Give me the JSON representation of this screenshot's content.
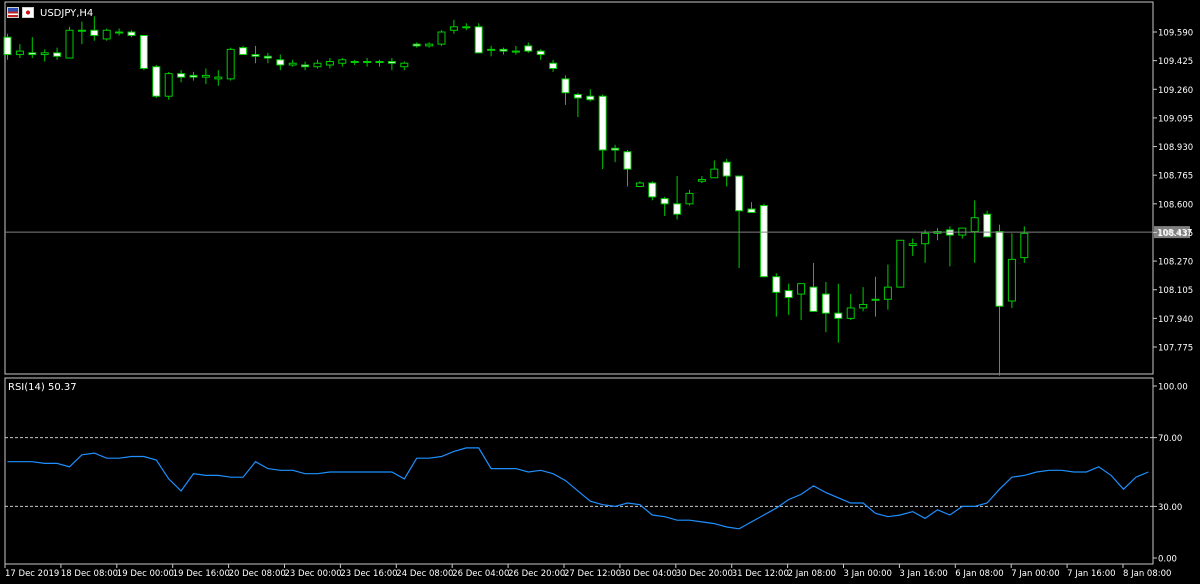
{
  "window": {
    "title": "USDJPY,H4"
  },
  "colors": {
    "background": "#000000",
    "frame": "#c8c8c8",
    "text": "#ffffff",
    "up_candle_body": "#000000",
    "down_candle_body": "#ffffff",
    "wick": "#00cc00",
    "bid_line": "#808080",
    "price_tag_bg": "#808080",
    "rsi_line": "#1e90ff",
    "rsi_levels": "#c8c8c8"
  },
  "chart_data": [
    {
      "type": "candlestick",
      "title": "USDJPY,H4",
      "symbol": "USDJPY",
      "timeframe": "H4",
      "y_ticks": [
        "109.590",
        "109.425",
        "109.260",
        "109.095",
        "108.930",
        "108.765",
        "108.600",
        "108.435",
        "108.270",
        "108.105",
        "107.940",
        "107.775"
      ],
      "ylim": [
        107.68,
        109.69
      ],
      "current_price_label": "108.437",
      "current_price": 108.437,
      "x_tick_labels": [
        "17 Dec 2019",
        "18 Dec 08:00",
        "19 Dec 00:00",
        "19 Dec 16:00",
        "20 Dec 08:00",
        "23 Dec 00:00",
        "23 Dec 16:00",
        "24 Dec 08:00",
        "26 Dec 04:00",
        "26 Dec 20:00",
        "27 Dec 12:00",
        "30 Dec 04:00",
        "30 Dec 20:00",
        "31 Dec 12:00",
        "2 Jan 08:00",
        "3 Jan 00:00",
        "3 Jan 16:00",
        "6 Jan 08:00",
        "7 Jan 00:00",
        "7 Jan 16:00",
        "8 Jan 08:00"
      ],
      "candles": [
        {
          "o": 109.56,
          "h": 109.58,
          "l": 109.43,
          "c": 109.46
        },
        {
          "o": 109.46,
          "h": 109.52,
          "l": 109.44,
          "c": 109.48
        },
        {
          "o": 109.47,
          "h": 109.56,
          "l": 109.44,
          "c": 109.46
        },
        {
          "o": 109.46,
          "h": 109.49,
          "l": 109.42,
          "c": 109.47
        },
        {
          "o": 109.47,
          "h": 109.5,
          "l": 109.43,
          "c": 109.45
        },
        {
          "o": 109.44,
          "h": 109.62,
          "l": 109.44,
          "c": 109.6
        },
        {
          "o": 109.6,
          "h": 109.65,
          "l": 109.52,
          "c": 109.6
        },
        {
          "o": 109.6,
          "h": 109.68,
          "l": 109.54,
          "c": 109.57
        },
        {
          "o": 109.55,
          "h": 109.61,
          "l": 109.54,
          "c": 109.6
        },
        {
          "o": 109.59,
          "h": 109.61,
          "l": 109.57,
          "c": 109.59
        },
        {
          "o": 109.59,
          "h": 109.6,
          "l": 109.56,
          "c": 109.57
        },
        {
          "o": 109.57,
          "h": 109.57,
          "l": 109.37,
          "c": 109.38
        },
        {
          "o": 109.39,
          "h": 109.4,
          "l": 109.21,
          "c": 109.22
        },
        {
          "o": 109.22,
          "h": 109.36,
          "l": 109.2,
          "c": 109.35
        },
        {
          "o": 109.35,
          "h": 109.37,
          "l": 109.3,
          "c": 109.33
        },
        {
          "o": 109.34,
          "h": 109.36,
          "l": 109.31,
          "c": 109.33
        },
        {
          "o": 109.33,
          "h": 109.38,
          "l": 109.29,
          "c": 109.34
        },
        {
          "o": 109.32,
          "h": 109.37,
          "l": 109.28,
          "c": 109.33
        },
        {
          "o": 109.32,
          "h": 109.5,
          "l": 109.31,
          "c": 109.49
        },
        {
          "o": 109.5,
          "h": 109.51,
          "l": 109.46,
          "c": 109.46
        },
        {
          "o": 109.46,
          "h": 109.51,
          "l": 109.41,
          "c": 109.45
        },
        {
          "o": 109.45,
          "h": 109.47,
          "l": 109.41,
          "c": 109.44
        },
        {
          "o": 109.43,
          "h": 109.46,
          "l": 109.37,
          "c": 109.4
        },
        {
          "o": 109.4,
          "h": 109.43,
          "l": 109.39,
          "c": 109.41
        },
        {
          "o": 109.4,
          "h": 109.42,
          "l": 109.37,
          "c": 109.39
        },
        {
          "o": 109.39,
          "h": 109.43,
          "l": 109.38,
          "c": 109.41
        },
        {
          "o": 109.4,
          "h": 109.44,
          "l": 109.38,
          "c": 109.42
        },
        {
          "o": 109.41,
          "h": 109.44,
          "l": 109.39,
          "c": 109.43
        },
        {
          "o": 109.42,
          "h": 109.43,
          "l": 109.4,
          "c": 109.42
        },
        {
          "o": 109.42,
          "h": 109.44,
          "l": 109.39,
          "c": 109.42
        },
        {
          "o": 109.42,
          "h": 109.43,
          "l": 109.39,
          "c": 109.42
        },
        {
          "o": 109.42,
          "h": 109.44,
          "l": 109.37,
          "c": 109.41
        },
        {
          "o": 109.39,
          "h": 109.42,
          "l": 109.37,
          "c": 109.41
        },
        {
          "o": 109.52,
          "h": 109.53,
          "l": 109.5,
          "c": 109.51
        },
        {
          "o": 109.51,
          "h": 109.53,
          "l": 109.5,
          "c": 109.52
        },
        {
          "o": 109.52,
          "h": 109.6,
          "l": 109.51,
          "c": 109.59
        },
        {
          "o": 109.6,
          "h": 109.66,
          "l": 109.58,
          "c": 109.62
        },
        {
          "o": 109.62,
          "h": 109.64,
          "l": 109.6,
          "c": 109.62
        },
        {
          "o": 109.62,
          "h": 109.64,
          "l": 109.47,
          "c": 109.47
        },
        {
          "o": 109.49,
          "h": 109.51,
          "l": 109.45,
          "c": 109.49
        },
        {
          "o": 109.49,
          "h": 109.5,
          "l": 109.46,
          "c": 109.48
        },
        {
          "o": 109.48,
          "h": 109.51,
          "l": 109.46,
          "c": 109.48
        },
        {
          "o": 109.51,
          "h": 109.53,
          "l": 109.47,
          "c": 109.48
        },
        {
          "o": 109.48,
          "h": 109.49,
          "l": 109.43,
          "c": 109.46
        },
        {
          "o": 109.41,
          "h": 109.43,
          "l": 109.36,
          "c": 109.38
        },
        {
          "o": 109.32,
          "h": 109.34,
          "l": 109.17,
          "c": 109.24
        },
        {
          "o": 109.23,
          "h": 109.24,
          "l": 109.1,
          "c": 109.21
        },
        {
          "o": 109.22,
          "h": 109.26,
          "l": 109.19,
          "c": 109.2
        },
        {
          "o": 109.22,
          "h": 109.23,
          "l": 108.8,
          "c": 108.91
        },
        {
          "o": 108.92,
          "h": 108.94,
          "l": 108.84,
          "c": 108.91
        },
        {
          "o": 108.9,
          "h": 108.91,
          "l": 108.7,
          "c": 108.8
        },
        {
          "o": 108.7,
          "h": 108.73,
          "l": 108.71,
          "c": 108.72
        },
        {
          "o": 108.72,
          "h": 108.73,
          "l": 108.62,
          "c": 108.64
        },
        {
          "o": 108.63,
          "h": 108.64,
          "l": 108.53,
          "c": 108.6
        },
        {
          "o": 108.6,
          "h": 108.76,
          "l": 108.51,
          "c": 108.54
        },
        {
          "o": 108.6,
          "h": 108.68,
          "l": 108.59,
          "c": 108.66
        },
        {
          "o": 108.73,
          "h": 108.76,
          "l": 108.72,
          "c": 108.74
        },
        {
          "o": 108.75,
          "h": 108.85,
          "l": 108.75,
          "c": 108.8
        },
        {
          "o": 108.84,
          "h": 108.86,
          "l": 108.7,
          "c": 108.76
        },
        {
          "o": 108.76,
          "h": 108.73,
          "l": 108.23,
          "c": 108.56
        },
        {
          "o": 108.57,
          "h": 108.61,
          "l": 108.56,
          "c": 108.55
        },
        {
          "o": 108.59,
          "h": 108.6,
          "l": 108.19,
          "c": 108.18
        },
        {
          "o": 108.18,
          "h": 108.2,
          "l": 107.95,
          "c": 108.09
        },
        {
          "o": 108.1,
          "h": 108.14,
          "l": 107.96,
          "c": 108.06
        },
        {
          "o": 108.08,
          "h": 108.13,
          "l": 107.93,
          "c": 108.14
        },
        {
          "o": 108.12,
          "h": 108.26,
          "l": 107.98,
          "c": 107.98
        },
        {
          "o": 108.08,
          "h": 108.15,
          "l": 107.86,
          "c": 107.97
        },
        {
          "o": 107.97,
          "h": 108.14,
          "l": 107.8,
          "c": 107.94
        },
        {
          "o": 107.94,
          "h": 108.08,
          "l": 107.93,
          "c": 108.0
        },
        {
          "o": 108.0,
          "h": 108.12,
          "l": 107.98,
          "c": 108.02
        },
        {
          "o": 108.05,
          "h": 108.18,
          "l": 107.95,
          "c": 108.05
        },
        {
          "o": 108.05,
          "h": 108.25,
          "l": 107.99,
          "c": 108.12
        },
        {
          "o": 108.12,
          "h": 108.36,
          "l": 108.14,
          "c": 108.39
        },
        {
          "o": 108.36,
          "h": 108.4,
          "l": 108.3,
          "c": 108.37
        },
        {
          "o": 108.37,
          "h": 108.45,
          "l": 108.26,
          "c": 108.43
        },
        {
          "o": 108.43,
          "h": 108.46,
          "l": 108.39,
          "c": 108.44
        },
        {
          "o": 108.45,
          "h": 108.47,
          "l": 108.24,
          "c": 108.42
        },
        {
          "o": 108.42,
          "h": 108.44,
          "l": 108.4,
          "c": 108.46
        },
        {
          "o": 108.44,
          "h": 108.62,
          "l": 108.26,
          "c": 108.52
        },
        {
          "o": 108.54,
          "h": 108.56,
          "l": 108.41,
          "c": 108.41
        },
        {
          "o": 108.44,
          "h": 108.48,
          "l": 107.61,
          "c": 108.01
        },
        {
          "o": 108.04,
          "h": 108.43,
          "l": 108.0,
          "c": 108.28
        },
        {
          "o": 108.29,
          "h": 108.47,
          "l": 108.26,
          "c": 108.43
        }
      ]
    },
    {
      "type": "line",
      "title": "RSI(14) 50.37",
      "indicator": "RSI(14)",
      "current_value": 50.37,
      "ylim": [
        0,
        100
      ],
      "y_ticks": [
        "100.00",
        "70.00",
        "30.00",
        "0.00"
      ],
      "levels": [
        70,
        30
      ],
      "values": [
        56,
        56,
        56,
        55,
        55,
        53,
        60,
        61,
        58,
        58,
        59,
        59,
        57,
        46,
        39,
        49,
        48,
        48,
        47,
        47,
        56,
        52,
        51,
        51,
        49,
        49,
        50,
        50,
        50,
        50,
        50,
        50,
        46,
        58,
        58,
        59,
        62,
        64,
        64,
        52,
        52,
        52,
        50,
        51,
        49,
        45,
        39,
        33,
        31,
        30,
        32,
        31,
        25,
        24,
        22,
        22,
        21,
        20,
        18,
        17,
        21,
        25,
        29,
        34,
        37,
        42,
        38,
        35,
        32,
        32,
        26,
        24,
        25,
        27,
        23,
        28,
        25,
        30,
        30,
        32,
        40,
        47,
        48,
        50,
        51,
        51,
        50,
        50,
        53,
        48,
        40,
        47,
        50
      ]
    }
  ]
}
